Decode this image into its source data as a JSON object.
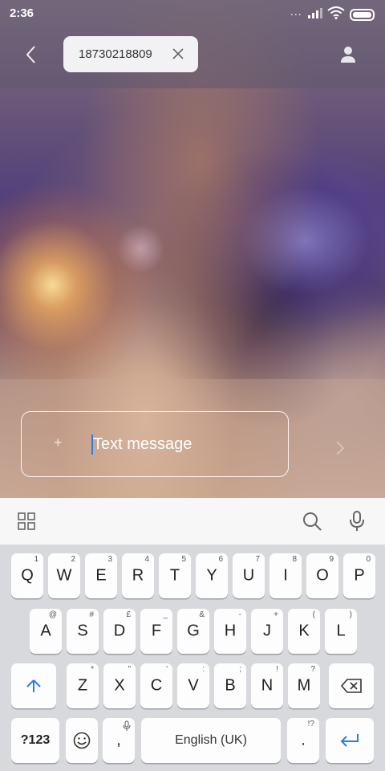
{
  "status_bar": {
    "time": "2:36",
    "dots": "..."
  },
  "header": {
    "recipient_number": "18730218809"
  },
  "composer": {
    "placeholder": "Text message"
  },
  "keyboard": {
    "row1": [
      {
        "label": "Q",
        "hint": "1"
      },
      {
        "label": "W",
        "hint": "2"
      },
      {
        "label": "E",
        "hint": "3"
      },
      {
        "label": "R",
        "hint": "4"
      },
      {
        "label": "T",
        "hint": "5"
      },
      {
        "label": "Y",
        "hint": "6"
      },
      {
        "label": "U",
        "hint": "7"
      },
      {
        "label": "I",
        "hint": "8"
      },
      {
        "label": "O",
        "hint": "9"
      },
      {
        "label": "P",
        "hint": "0"
      }
    ],
    "row2": [
      {
        "label": "A",
        "hint": "@"
      },
      {
        "label": "S",
        "hint": "#"
      },
      {
        "label": "D",
        "hint": "£"
      },
      {
        "label": "F",
        "hint": "_"
      },
      {
        "label": "G",
        "hint": "&"
      },
      {
        "label": "H",
        "hint": "-"
      },
      {
        "label": "J",
        "hint": "+"
      },
      {
        "label": "K",
        "hint": "("
      },
      {
        "label": "L",
        "hint": ")"
      }
    ],
    "row3": [
      {
        "label": "Z",
        "hint": "*"
      },
      {
        "label": "X",
        "hint": "\""
      },
      {
        "label": "C",
        "hint": "'"
      },
      {
        "label": "V",
        "hint": ":"
      },
      {
        "label": "B",
        "hint": ";"
      },
      {
        "label": "N",
        "hint": "!"
      },
      {
        "label": "M",
        "hint": "?"
      }
    ],
    "symbols_label": "?123",
    "comma_label": ",",
    "space_label": "English (UK)",
    "period_label": ".",
    "period_hint": "!?"
  },
  "colors": {
    "accent": "#2b7de9"
  }
}
